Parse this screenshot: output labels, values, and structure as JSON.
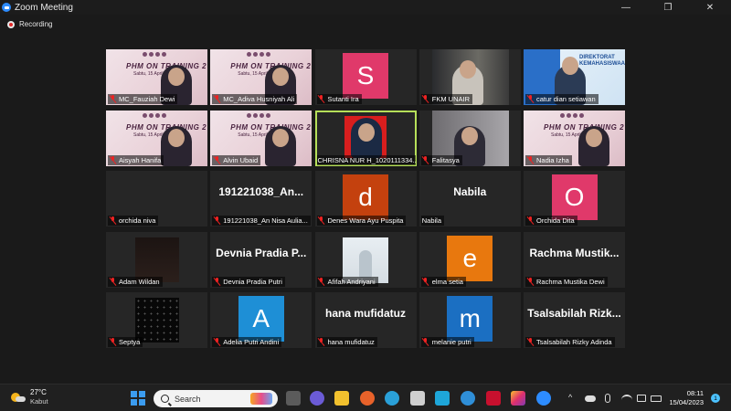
{
  "window": {
    "title": "Zoom Meeting",
    "controls": [
      "—",
      "❐",
      "✕"
    ]
  },
  "recording": {
    "label": "Recording"
  },
  "tiles": [
    {
      "name": "MC_Fauziah Dewi",
      "kind": "banner",
      "title": "PHM ON TRAINING 2",
      "sub": "Sabtu, 15 April 2023",
      "muted": true
    },
    {
      "name": "MC_Adiva Husniyah Ali",
      "kind": "banner",
      "title": "PHM ON TRAINING 2",
      "sub": "Sabtu, 15 April 2023",
      "muted": true
    },
    {
      "name": "Sutanti Ira",
      "kind": "avatar",
      "letter": "S",
      "color": "#e0396a",
      "muted": true
    },
    {
      "name": "FKM UNAIR",
      "kind": "video-car",
      "muted": true
    },
    {
      "name": "catur dian setiawan",
      "kind": "video-banner2",
      "banner_text": "DIREKTORAT KEMAHASISWAAN",
      "muted": true
    },
    {
      "name": "Aisyah Hanifa",
      "kind": "banner",
      "title": "PHM ON TRAINING 2",
      "sub": "Sabtu, 15 April 2023",
      "muted": true
    },
    {
      "name": "Alvin Ubaid",
      "kind": "banner",
      "title": "PHM ON TRAINING 2",
      "sub": "Sabtu, 15 April 2023",
      "muted": true
    },
    {
      "name": "CHRISNA NUR H_1020111334...",
      "kind": "speaker",
      "muted": false
    },
    {
      "name": "Falitasya",
      "kind": "video-girl",
      "muted": true
    },
    {
      "name": "Nadia Izha",
      "kind": "banner",
      "title": "PHM ON TRAINING 2",
      "sub": "Sabtu, 15 April 2023",
      "muted": true
    },
    {
      "name": "orchida niva",
      "kind": "blank",
      "muted": true
    },
    {
      "name": "191221038_An Nisa Aulia...",
      "kind": "text",
      "big": "191221038_An...",
      "muted": true
    },
    {
      "name": "Denes Wara Ayu Puspita",
      "kind": "avatar",
      "letter": "d",
      "color": "#c4410e",
      "muted": true
    },
    {
      "name": "Nabila",
      "kind": "text",
      "big": "Nabila",
      "muted": false
    },
    {
      "name": "Orchida Dita",
      "kind": "avatar",
      "letter": "O",
      "color": "#e0396a",
      "muted": true
    },
    {
      "name": "Adam Wildan",
      "kind": "dark-photo",
      "muted": true
    },
    {
      "name": "Devnia Pradia Putri",
      "kind": "text",
      "big": "Devnia Pradia P...",
      "muted": true
    },
    {
      "name": "Afifah Andriyani",
      "kind": "hijab-photo",
      "muted": true
    },
    {
      "name": "elma setia",
      "kind": "avatar",
      "letter": "e",
      "color": "#e8780e",
      "muted": true
    },
    {
      "name": "Rachma Mustika Dewi",
      "kind": "text",
      "big": "Rachma Mustik...",
      "muted": true
    },
    {
      "name": "Septya",
      "kind": "starry",
      "muted": true
    },
    {
      "name": "Adelia Putri Andini",
      "kind": "avatar",
      "letter": "A",
      "color": "#1e8fd6",
      "muted": true
    },
    {
      "name": "hana mufidatuz",
      "kind": "text",
      "big": "hana mufidatuz",
      "muted": true
    },
    {
      "name": "melanie putri",
      "kind": "avatar",
      "letter": "m",
      "color": "#1b6fc2",
      "muted": true
    },
    {
      "name": "Tsalsabilah Rizky Adinda",
      "kind": "text",
      "big": "Tsalsabilah Rizk...",
      "muted": true
    }
  ],
  "taskbar": {
    "weather": {
      "temp": "27°C",
      "condition": "Kabut"
    },
    "search_label": "Search",
    "apps": [
      "task-view",
      "zoom-chat",
      "file-explorer",
      "firefox",
      "edge",
      "store",
      "chart-app",
      "browser-app",
      "mcafee",
      "instagram",
      "zoom"
    ],
    "tray": {
      "chevron": "^",
      "time": "08:11",
      "date": "15/04/2023",
      "notifications": "1"
    }
  }
}
